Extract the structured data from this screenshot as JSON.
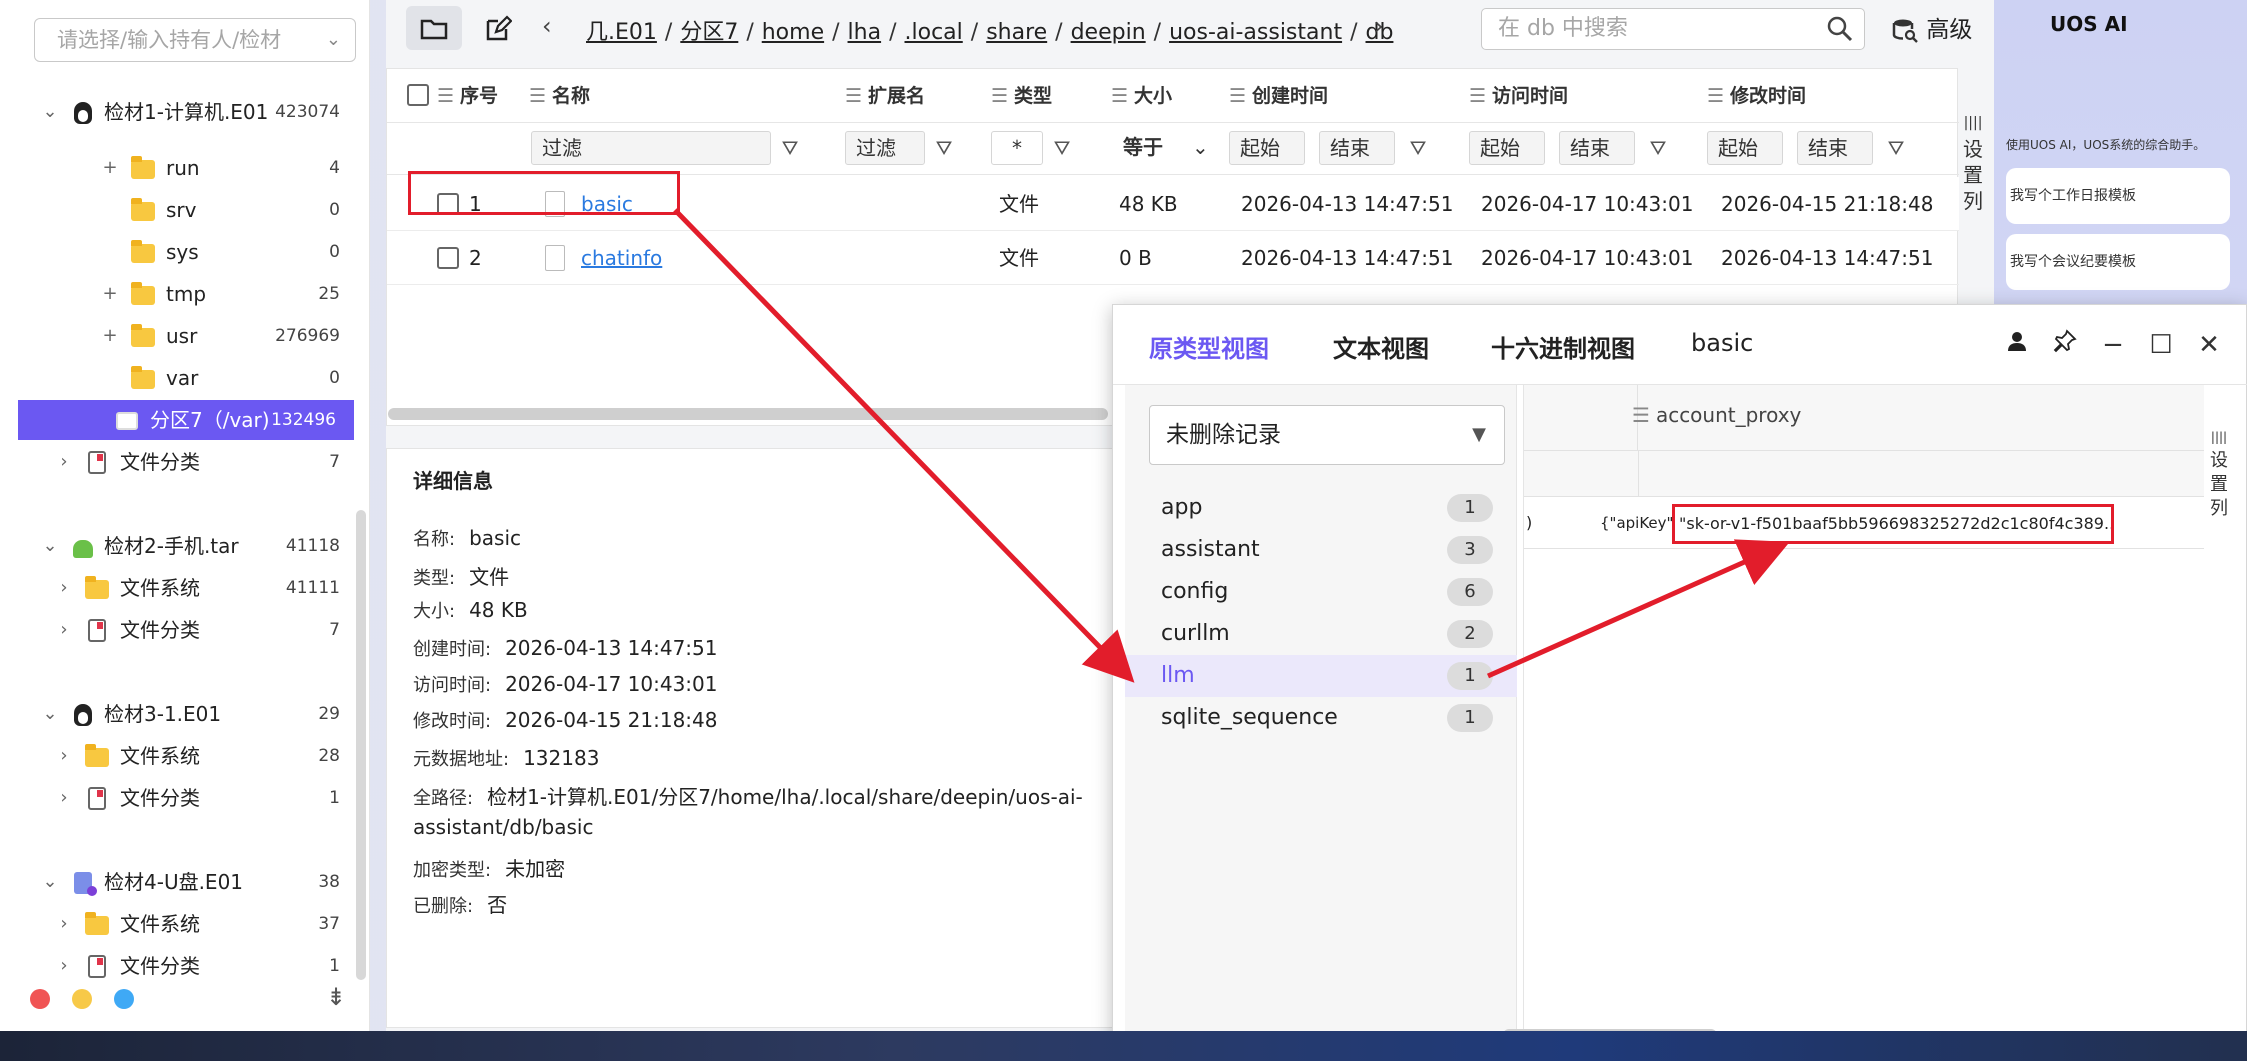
{
  "left_panel": {
    "holder_placeholder": "请选择/输入持有人/检材",
    "tree": [
      {
        "label": "检材1-计算机.E01",
        "count": "423074"
      },
      {
        "label": "run",
        "count": "4"
      },
      {
        "label": "srv",
        "count": "0"
      },
      {
        "label": "sys",
        "count": "0"
      },
      {
        "label": "tmp",
        "count": "25"
      },
      {
        "label": "usr",
        "count": "276969"
      },
      {
        "label": "var",
        "count": "0"
      },
      {
        "label": "分区7（/var)",
        "count": "132496"
      },
      {
        "label": "文件分类",
        "count": "7"
      },
      {
        "label": "检材2-手机.tar",
        "count": "41118"
      },
      {
        "label": "文件系统",
        "count": "41111"
      },
      {
        "label": "文件分类",
        "count": "7"
      },
      {
        "label": "检材3-1.E01",
        "count": "29"
      },
      {
        "label": "文件系统",
        "count": "28"
      },
      {
        "label": "文件分类",
        "count": "1"
      },
      {
        "label": "检材4-U盘.E01",
        "count": "38"
      },
      {
        "label": "文件系统",
        "count": "37"
      },
      {
        "label": "文件分类",
        "count": "1"
      }
    ],
    "dot_colors": [
      "#f05454",
      "#f7c948",
      "#3fa9f5"
    ]
  },
  "toolbar": {
    "breadcrumb": [
      "几.E01",
      "分区7",
      "home",
      "lha",
      ".local",
      "share",
      "deepin",
      "uos-ai-assistant",
      "db"
    ],
    "search_placeholder": "在 db 中搜索",
    "advanced_label": "高级"
  },
  "table": {
    "headers": {
      "index": "序号",
      "name": "名称",
      "ext": "扩展名",
      "type": "类型",
      "size": "大小",
      "created": "创建时间",
      "accessed": "访问时间",
      "modified": "修改时间"
    },
    "filters": {
      "name": "过滤",
      "ext": "过滤",
      "type": "*",
      "size": "等于",
      "created_start": "起始",
      "created_end": "结束",
      "accessed_start": "起始",
      "accessed_end": "结束",
      "modified_start": "起始",
      "modified_end": "结束"
    },
    "rows": [
      {
        "index": "1",
        "name": "basic",
        "type": "文件",
        "size": "48 KB",
        "created": "2026-04-13 14:47:51",
        "accessed": "2026-04-17 10:43:01",
        "modified": "2026-04-15 21:18:48"
      },
      {
        "index": "2",
        "name": "chatinfo",
        "type": "文件",
        "size": "0 B",
        "created": "2026-04-13 14:47:51",
        "accessed": "2026-04-17 10:43:01",
        "modified": "2026-04-13 14:47:51"
      }
    ],
    "set_columns": "设置列"
  },
  "details": {
    "title": "详细信息",
    "name_k": "名称:",
    "name_v": "basic",
    "type_k": "类型:",
    "type_v": "文件",
    "size_k": "大小:",
    "size_v": "48 KB",
    "created_k": "创建时间:",
    "created_v": "2026-04-13 14:47:51",
    "accessed_k": "访问时间:",
    "accessed_v": "2026-04-17 10:43:01",
    "modified_k": "修改时间:",
    "modified_v": "2026-04-15 21:18:48",
    "meta_k": "元数据地址:",
    "meta_v": "132183",
    "path_k": "全路径:",
    "path_v1": "检材1-计算机.E01/分区7/home/lha/.local/share/deepin/uos-ai-",
    "path_v2": "assistant/db/basic",
    "enc_k": "加密类型:",
    "enc_v": "未加密",
    "del_k": "已删除:",
    "del_v": "否"
  },
  "uos": {
    "title": "UOS AI",
    "subtitle": "使用UOS AI，UOS系统的综合助手。",
    "cards": [
      "我写个工作日报模板",
      "我写个会议纪要模板"
    ]
  },
  "viewer": {
    "tabs": [
      "原类型视图",
      "文本视图",
      "十六进制视图"
    ],
    "active_tab": 0,
    "filename": "basic",
    "record_select": "未删除记录",
    "tables": [
      {
        "name": "app",
        "count": "1"
      },
      {
        "name": "assistant",
        "count": "3"
      },
      {
        "name": "config",
        "count": "6"
      },
      {
        "name": "curllm",
        "count": "2"
      },
      {
        "name": "llm",
        "count": "1"
      },
      {
        "name": "sqlite_sequence",
        "count": "1"
      }
    ],
    "selected_table": "llm",
    "column": "account_proxy",
    "row_prefix_left": ")",
    "row_prefix": "{\"apiKey\"",
    "api_key_value": "\"sk-or-v1-f501baaf5bb596698325272d2c1c80f4c389...",
    "set_columns": "设置列"
  },
  "colors": {
    "accent": "#6b58f2",
    "highlight_red": "#e21d2b",
    "link": "#2a7ae0"
  }
}
